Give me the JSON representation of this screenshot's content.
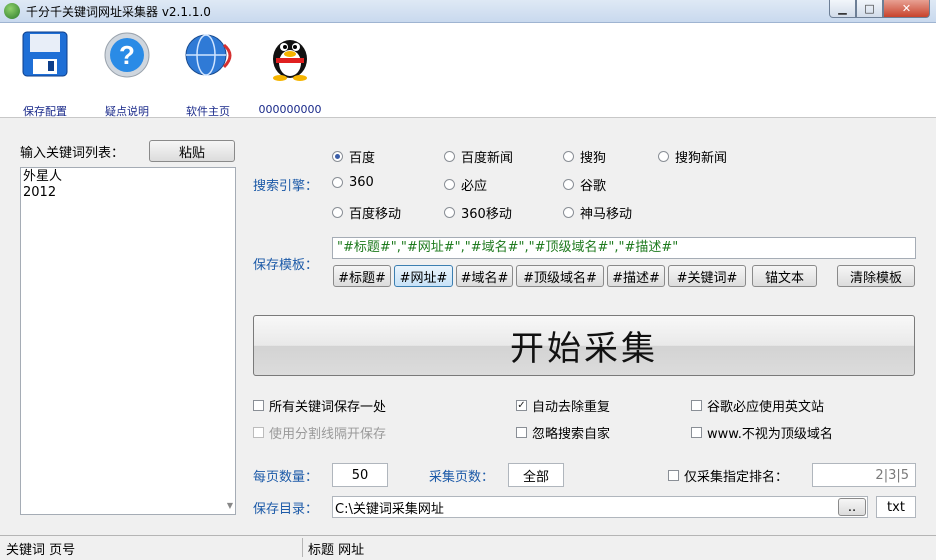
{
  "window": {
    "title": "千分千关键词网址采集器  v2.1.1.0",
    "controls": {
      "minimize": "▁",
      "maximize": "□",
      "close": "✕"
    }
  },
  "toolbar": {
    "items": [
      {
        "label": "保存配置",
        "icon": "floppy-disk-icon"
      },
      {
        "label": "疑点说明",
        "icon": "help-icon"
      },
      {
        "label": "软件主页",
        "icon": "globe-icon"
      },
      {
        "label": "000000000",
        "icon": "qq-penguin-icon"
      }
    ]
  },
  "keywords": {
    "label": "输入关键词列表：",
    "paste_label": "粘贴",
    "lines": [
      "外星人",
      "2012"
    ]
  },
  "engines": {
    "label": "搜索引擎：",
    "options": [
      {
        "label": "百度",
        "selected": true
      },
      {
        "label": "百度新闻",
        "selected": false
      },
      {
        "label": "搜狗",
        "selected": false
      },
      {
        "label": "搜狗新闻",
        "selected": false
      },
      {
        "label": "360",
        "selected": false
      },
      {
        "label": "必应",
        "selected": false
      },
      {
        "label": "谷歌",
        "selected": false
      },
      {
        "label": "百度移动",
        "selected": false
      },
      {
        "label": "360移动",
        "selected": false
      },
      {
        "label": "神马移动",
        "selected": false
      }
    ]
  },
  "template": {
    "label": "保存模板：",
    "value": "\"#标题#\",\"#网址#\",\"#域名#\",\"#顶级域名#\",\"#描述#\"",
    "tags": [
      "#标题#",
      "#网址#",
      "#域名#",
      "#顶级域名#",
      "#描述#",
      "#关键词#",
      "锚文本"
    ],
    "clear_label": "清除模板"
  },
  "start_label": "开始采集",
  "options": [
    {
      "label": "所有关键词保存一处",
      "checked": false,
      "enabled": true
    },
    {
      "label": "自动去除重复",
      "checked": true,
      "enabled": true
    },
    {
      "label": "谷歌必应使用英文站",
      "checked": false,
      "enabled": true
    },
    {
      "label": "使用分割线隔开保存",
      "checked": false,
      "enabled": false
    },
    {
      "label": "忽略搜索自家",
      "checked": false,
      "enabled": true
    },
    {
      "label": "www.不视为顶级域名",
      "checked": false,
      "enabled": true
    }
  ],
  "per_page": {
    "label": "每页数量：",
    "value": "50"
  },
  "pages": {
    "label": "采集页数：",
    "value": "全部"
  },
  "rank_filter": {
    "label": "仅采集指定排名：",
    "value": "2|3|5",
    "checked": false
  },
  "save_dir": {
    "label": "保存目录：",
    "value": "C:\\关键词采集网址",
    "browse_label": "..",
    "ext": "txt"
  },
  "status": {
    "left": "关键词  页号",
    "right": "标题  网址"
  }
}
